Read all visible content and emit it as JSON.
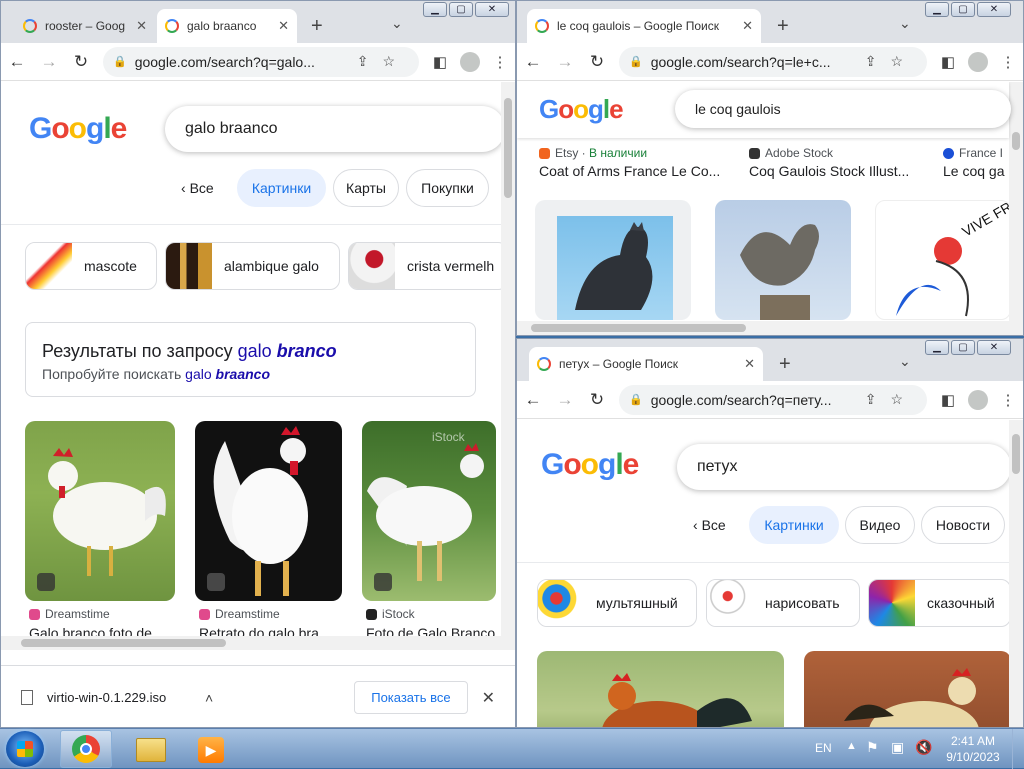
{
  "win1": {
    "tabs": [
      {
        "title": "rooster – Goog",
        "active": false
      },
      {
        "title": "galo braanco",
        "active": true
      }
    ],
    "url": "google.com/search?q=galo...",
    "query": "galo braanco",
    "chips": [
      {
        "label": "Все",
        "back": true
      },
      {
        "label": "Картинки",
        "selected": true
      },
      {
        "label": "Карты"
      },
      {
        "label": "Покупки"
      }
    ],
    "suggestions": [
      "mascote",
      "alambique galo",
      "crista vermelh"
    ],
    "correction": {
      "prefix": "Результаты по запросу ",
      "corr_plain": "galo ",
      "corr_bold": "branco",
      "try_prefix": "Попробуйте поискать ",
      "try_plain": "galo ",
      "try_bold": "braanco"
    },
    "results": [
      {
        "source": "Dreamstime",
        "caption": "Galo branco foto de ..."
      },
      {
        "source": "Dreamstime",
        "caption": "Retrato do galo bra..."
      },
      {
        "source": "iStock",
        "caption": "Foto de Galo Branco"
      }
    ],
    "download": {
      "filename": "virtio-win-0.1.229.iso",
      "show_all": "Показать все"
    }
  },
  "win2": {
    "tab_title": "le coq gaulois – Google Поиск",
    "url": "google.com/search?q=le+c...",
    "query": "le coq gaulois",
    "results": [
      {
        "source": "Etsy",
        "badge": "В наличии",
        "caption": "Coat of Arms France Le Co..."
      },
      {
        "source": "Adobe Stock",
        "caption": "Coq Gaulois Stock Illust..."
      },
      {
        "source": "France I",
        "caption": "Le coq ga"
      }
    ],
    "vive_text": "VIVE FRA"
  },
  "win3": {
    "tab_title": "петух – Google Поиск",
    "url": "google.com/search?q=пету...",
    "query": "петух",
    "chips": [
      {
        "label": "Все",
        "back": true
      },
      {
        "label": "Картинки",
        "selected": true
      },
      {
        "label": "Видео"
      },
      {
        "label": "Новости"
      }
    ],
    "suggestions": [
      "мультяшный",
      "нарисовать",
      "сказочный"
    ]
  },
  "logo": [
    {
      "ch": "G",
      "c": "#4285f4"
    },
    {
      "ch": "o",
      "c": "#ea4335"
    },
    {
      "ch": "o",
      "c": "#fbbc05"
    },
    {
      "ch": "g",
      "c": "#4285f4"
    },
    {
      "ch": "l",
      "c": "#34a853"
    },
    {
      "ch": "e",
      "c": "#ea4335"
    }
  ],
  "taskbar": {
    "lang": "EN",
    "time": "2:41 AM",
    "date": "9/10/2023"
  }
}
